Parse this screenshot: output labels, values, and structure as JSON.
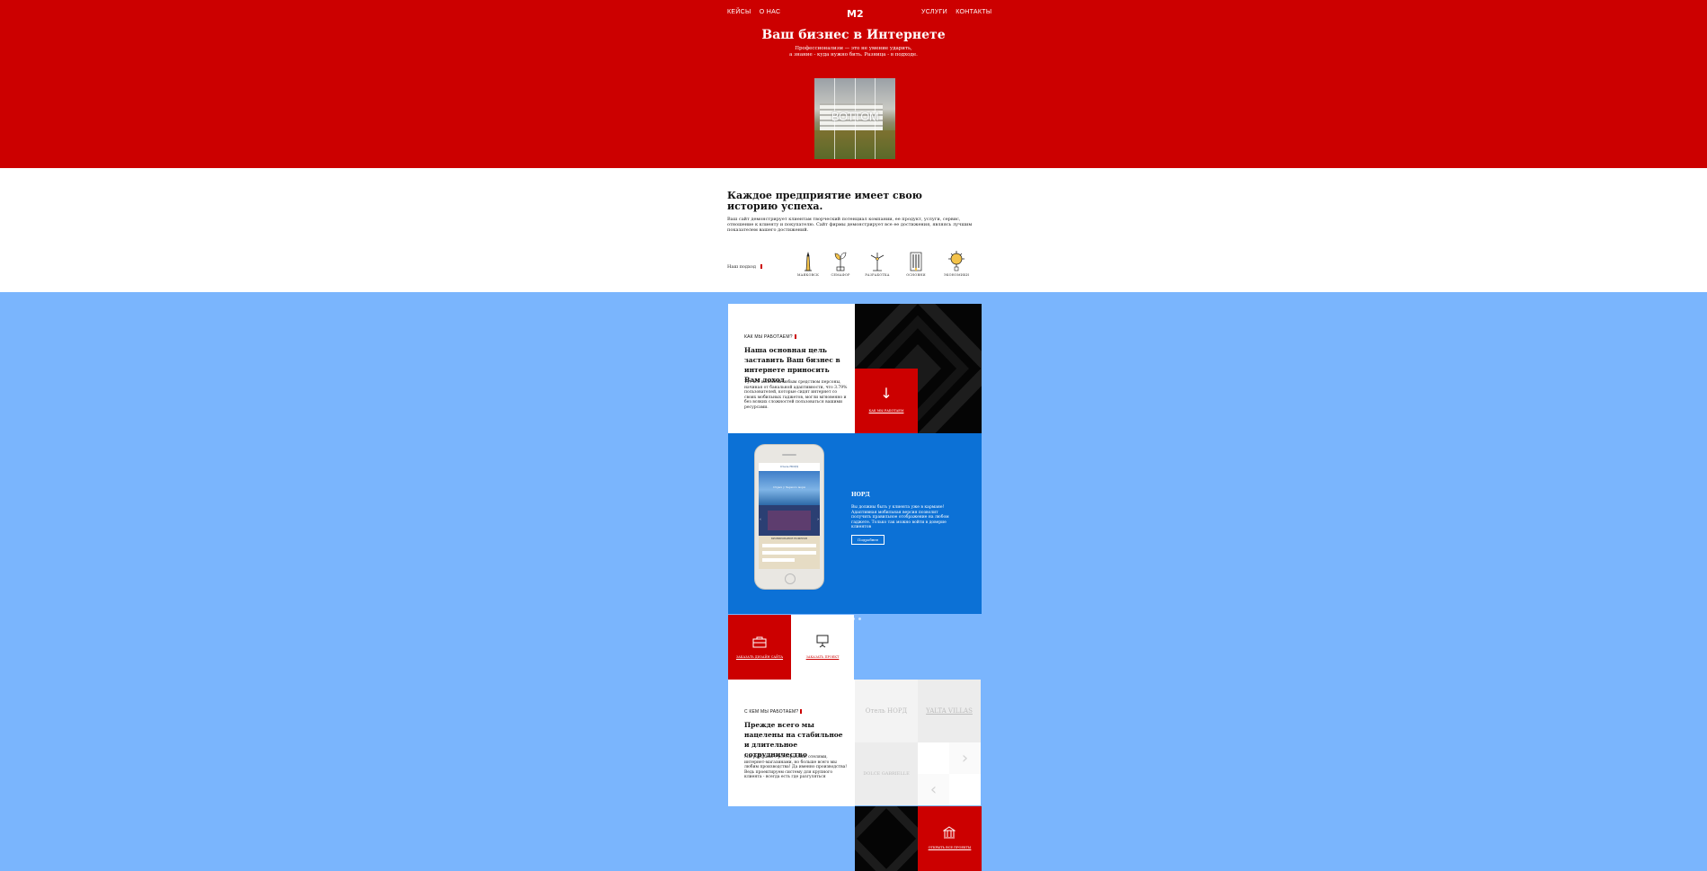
{
  "nav": {
    "left": [
      "КЕЙСЫ",
      "О НАС"
    ],
    "right": [
      "УСЛУГИ",
      "КОНТАКТЫ"
    ],
    "logo": "M2"
  },
  "hero": {
    "title": "Ваш бизнес в Интернете",
    "subtitle_line1": "Профессионализм — это не умение ударить,",
    "subtitle_line2": "а знание - куда нужно бить. Разница - в подходе.",
    "image_caption": "BOTTOM"
  },
  "about": {
    "heading": "Каждое предприятие имеет свою историю успеха.",
    "text": "Ваш сайт демонстрирует клиентам творческий потенциал компании, ее продукт, услуги, сервис, отношение к клиенту и покупателю. Сайт фирмы демонстрирует все ее достижения, являясь лучшим показателем вашего достижений.",
    "approach_label": "Наш подход",
    "approach": [
      {
        "icon": "lighthouse-icon",
        "label": "МАЯКОВСК"
      },
      {
        "icon": "sprout-icon",
        "label": "СЕМАФОР"
      },
      {
        "icon": "windmill-icon",
        "label": "РАЗРАБОТКА"
      },
      {
        "icon": "organ-icon",
        "label": "ОСНОВНИ"
      },
      {
        "icon": "gear-idea-icon",
        "label": "ЭКОНОМИКИ"
      }
    ]
  },
  "how_we_work": {
    "label": "КАК МЫ РАБОТАЕМ?",
    "heading": "Наша основная цель заставить Ваш бизнес в интернете приносить Вам доход",
    "text": "Тут все не вейбы любым средством персоны, начиная от банальной адаптивности, что 3.79% пользователей, которые сидят интернет со своих мобильных гаджетов, могли мгновенно и без всяких сложностей пользоваться вашими ресурсами.",
    "red_link": "КАК МЫ РАБОТАЕМ"
  },
  "slider": {
    "title": "НОРД",
    "text": "Вы должны быть у клиента уже в кармане! Адаптивная мобильная версия позволит получить правильное отображение на любом гаджете. Только так можно войти в доверие клиентов",
    "button": "Подробнее",
    "dots": 3,
    "active_dot": 1,
    "phone_header": "Отель НОРД",
    "phone_tagline": "Отдых у Черного моря",
    "phone_form_title": "БРОНИРОВАНИЕ НОМЕРОВ"
  },
  "squares": [
    {
      "icon": "briefcase-icon",
      "label": "ЗАКАЗАТЬ ДИЗАЙН САЙТА"
    },
    {
      "icon": "presentation-icon",
      "label": "ЗАКАЗАТЬ ПРОЕКТ"
    }
  ],
  "clients": {
    "label": "С КЕМ МЫ РАБОТАЕМ?",
    "heading": "Прежде всего мы нацелены на стабильное и длительное сотрудничество",
    "text": "Мы работаем с ресторанами, отелями, интернет-магазинами, но больше всего мы любим производства! Да именно производства! Ведь проектируем систему для крупного клиента - всегда есть где разгуляться",
    "logos": [
      "Отель НОРД",
      "YALTA VILLAS",
      "DOLCE GABRIELLE"
    ],
    "bottom_link": "ОТКРЫТЬ ВСЕ ПРОЕКТЫ"
  },
  "colors": {
    "brand_red": "#cc0000",
    "page_blue": "#7ab5fd",
    "slider_blue": "#0c71d6"
  }
}
